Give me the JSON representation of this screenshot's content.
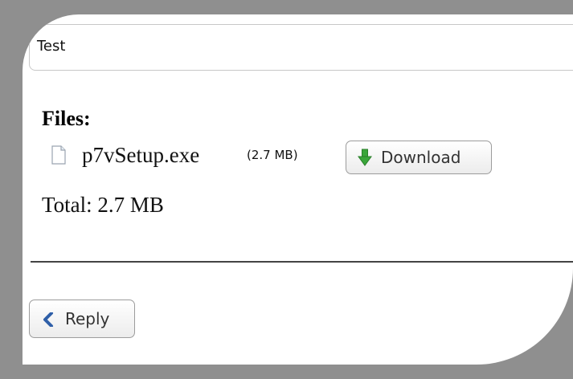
{
  "message": {
    "subject": "Test"
  },
  "attachments": {
    "heading": "Files:",
    "files": [
      {
        "name": "p7vSetup.exe",
        "size": "(2.7 MB)",
        "icon": "file-icon",
        "download_label": "Download"
      }
    ],
    "total": "Total: 2.7 MB"
  },
  "actions": {
    "reply_label": "Reply"
  },
  "colors": {
    "frame": "#8f8f8f",
    "download_arrow": "#3aa63a",
    "reply_chevron": "#2f5fa8"
  }
}
